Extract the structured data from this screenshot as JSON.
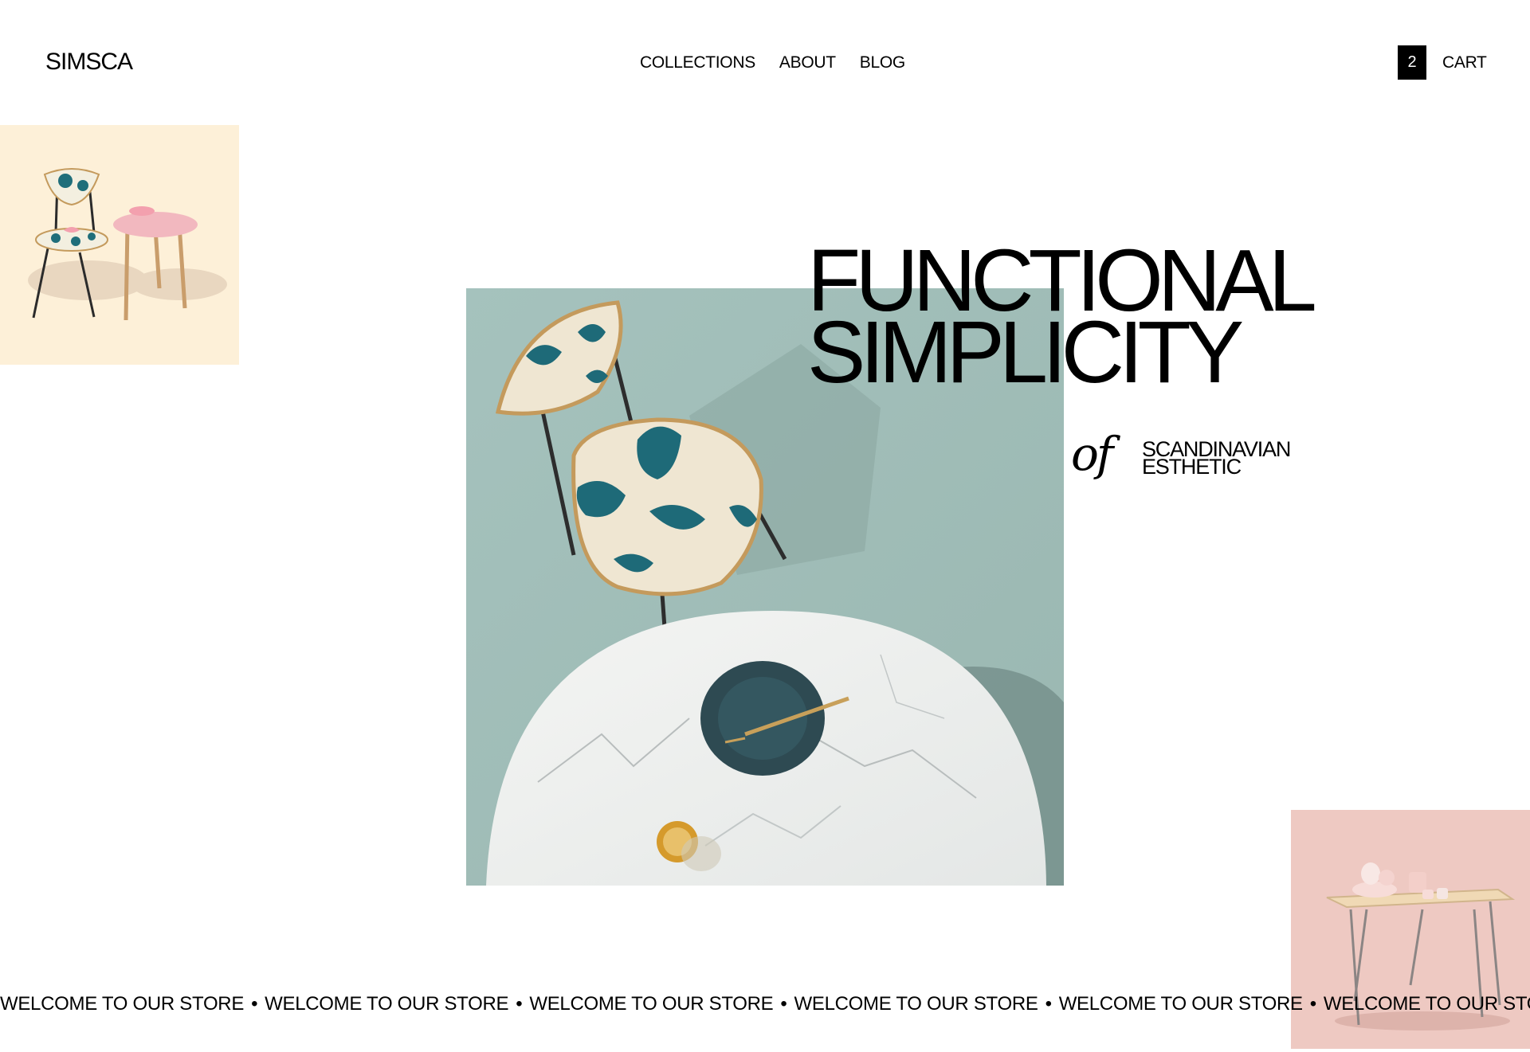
{
  "header": {
    "logo": "SIMSCA",
    "nav": [
      {
        "label": "COLLECTIONS"
      },
      {
        "label": "ABOUT"
      },
      {
        "label": "BLOG"
      }
    ],
    "cart": {
      "count": "2",
      "label": "CART"
    }
  },
  "hero": {
    "headline_line1": "FUNCTIONAL",
    "headline_line2": "SIMPLICITY",
    "connector": "of",
    "sub_line1": "SCANDINAVIAN",
    "sub_line2": "ESTHETIC"
  },
  "marquee": {
    "text": "WELCOME TO OUR STORE",
    "separator": "•"
  },
  "colors": {
    "hero_background": "#a9c6c2",
    "topleft_background": "#fdf0d8",
    "bottomright_background": "#eec9c2"
  }
}
